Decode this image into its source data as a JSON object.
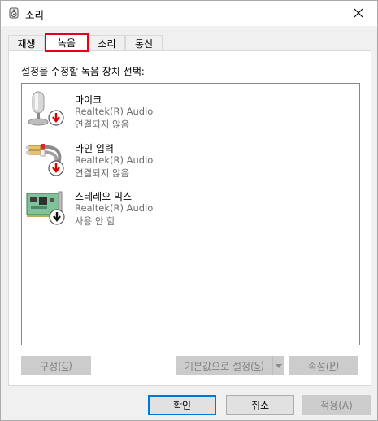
{
  "window": {
    "title": "소리",
    "close_label": "✕"
  },
  "tabs": [
    {
      "label": "재생",
      "active": false
    },
    {
      "label": "녹음",
      "active": true
    },
    {
      "label": "소리",
      "active": false
    },
    {
      "label": "통신",
      "active": false
    }
  ],
  "panel": {
    "instruction": "설정을 수정할 녹음 장치 선택:"
  },
  "devices": [
    {
      "name": "마이크",
      "driver": "Realtek(R) Audio",
      "state": "연결되지 않음",
      "icon": "microphone-icon",
      "badge": "red-down-arrow"
    },
    {
      "name": "라인 입력",
      "driver": "Realtek(R) Audio",
      "state": "연결되지 않음",
      "icon": "line-in-cable-icon",
      "badge": "red-down-arrow"
    },
    {
      "name": "스테레오 믹스",
      "driver": "Realtek(R) Audio",
      "state": "사용 안 함",
      "icon": "sound-card-icon",
      "badge": "black-down-arrow"
    }
  ],
  "panel_buttons": {
    "configure": {
      "label": "구성(",
      "mnemonic": "C",
      "suffix": ")"
    },
    "set_default": {
      "label": "기본값으로 설정(",
      "mnemonic": "S",
      "suffix": ")"
    },
    "properties": {
      "label": "속성(",
      "mnemonic": "P",
      "suffix": ")"
    }
  },
  "dialog_buttons": {
    "ok": "확인",
    "cancel": "취소",
    "apply": {
      "label": "적용(",
      "mnemonic": "A",
      "suffix": ")"
    }
  },
  "colors": {
    "tab_highlight": "#e2001a",
    "default_button_border": "#0078d7",
    "disabled_text": "#838383"
  }
}
